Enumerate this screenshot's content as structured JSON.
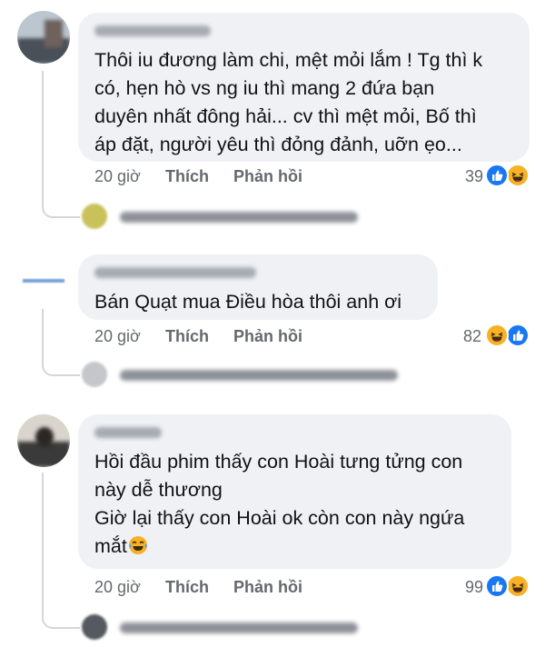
{
  "comments": [
    {
      "text_lines": [
        "Thôi iu đương làm chi, mệt mỏi lắm ! Tg thì k",
        "có, hẹn hò vs ng iu thì mang 2 đứa bạn",
        "duyên nhất đông hải... cv thì mệt mỏi, Bố thì",
        "áp đặt, người yêu thì đỏng đảnh, uỡn ẹo..."
      ],
      "time": "20 giờ",
      "like_label": "Thích",
      "reply_label": "Phản hồi",
      "reaction_count": "39",
      "reactions": [
        "like-icon",
        "haha-icon"
      ]
    },
    {
      "text_lines": [
        "Bán Quạt mua Điều hòa thôi anh ơi"
      ],
      "time": "20 giờ",
      "like_label": "Thích",
      "reply_label": "Phản hồi",
      "reaction_count": "82",
      "reactions": [
        "haha-icon",
        "like-icon"
      ]
    },
    {
      "text_lines": [
        "Hồi đầu phim thấy con Hoài tưng tửng con",
        "này dễ thương",
        "Giờ lại thấy con Hoài ok còn con này ngứa",
        "mắt"
      ],
      "time": "20 giờ",
      "like_label": "Thích",
      "reply_label": "Phản hồi",
      "reaction_count": "99",
      "reactions": [
        "like-icon",
        "haha-icon"
      ]
    }
  ],
  "colors": {
    "bubble": "#eff1f4",
    "meta_text": "#65686d",
    "like_blue": "#1877f2",
    "haha_yellow": "#f7b125",
    "thread_line": "#d3d6db"
  }
}
